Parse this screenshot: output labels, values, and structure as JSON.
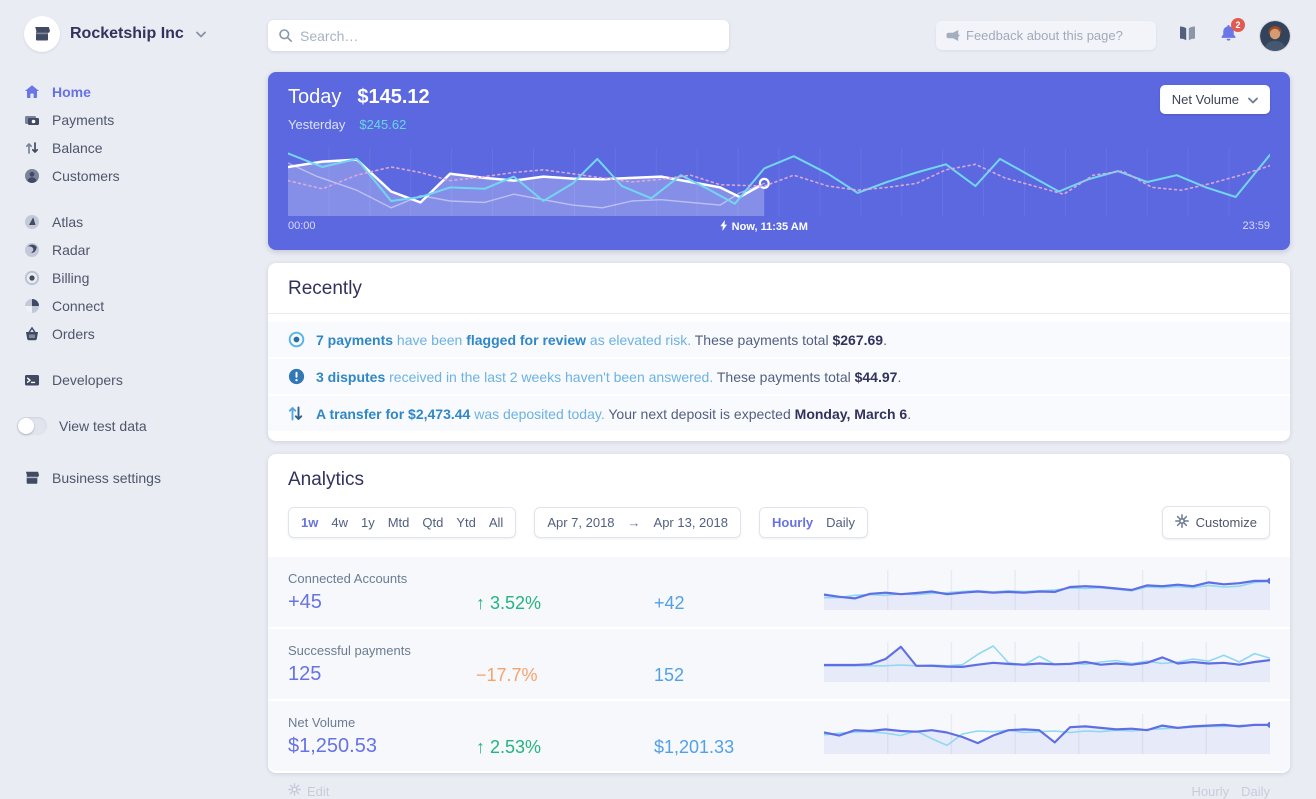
{
  "colors": {
    "accent": "#6772e5",
    "chart_bg": "#5b68e0",
    "green": "#24b47e",
    "orange": "#f5a26b",
    "metric_blue": "#53a0e8",
    "cyan_line": "#73d6f0",
    "pink_line": "#d9a8dc",
    "badge_red": "#e25950",
    "yesterday_teal": "#66d9e2"
  },
  "brand": {
    "name": "Rocketship Inc",
    "icon": "storefront-icon"
  },
  "topbar": {
    "search_placeholder": "Search…",
    "feedback_placeholder": "Feedback about this page?",
    "notification_count": "2"
  },
  "sidebar": {
    "groups": [
      {
        "items": [
          {
            "label": "Home",
            "icon": "home-icon",
            "active": true
          },
          {
            "label": "Payments",
            "icon": "payments-icon"
          },
          {
            "label": "Balance",
            "icon": "balance-icon"
          },
          {
            "label": "Customers",
            "icon": "customers-icon"
          }
        ]
      },
      {
        "items": [
          {
            "label": "Atlas",
            "icon": "atlas-icon"
          },
          {
            "label": "Radar",
            "icon": "radar-icon"
          },
          {
            "label": "Billing",
            "icon": "billing-icon"
          },
          {
            "label": "Connect",
            "icon": "connect-icon"
          },
          {
            "label": "Orders",
            "icon": "orders-icon"
          }
        ]
      },
      {
        "items": [
          {
            "label": "Developers",
            "icon": "developers-icon"
          }
        ]
      }
    ],
    "test_data_label": "View test data",
    "business_label": "Business settings"
  },
  "today_card": {
    "title": "Today",
    "amount": "$145.12",
    "yesterday_label": "Yesterday",
    "yesterday_amount": "$245.62",
    "selector_label": "Net Volume",
    "axis_start": "00:00",
    "axis_now": "Now, 11:35 AM",
    "axis_end": "23:59"
  },
  "recently": {
    "title": "Recently",
    "items": [
      {
        "icon": "review-icon",
        "segments": [
          [
            "7 payments",
            "lb"
          ],
          [
            " have been ",
            "l"
          ],
          [
            "flagged for review",
            "lb"
          ],
          [
            " as elevated risk.",
            "l"
          ],
          [
            " These payments total ",
            "p"
          ],
          [
            "$267.69",
            "b"
          ],
          [
            ".",
            "p"
          ]
        ]
      },
      {
        "icon": "alert-icon",
        "segments": [
          [
            "3 disputes",
            "lb"
          ],
          [
            " received in the last 2 weeks haven't been answered.",
            "l"
          ],
          [
            " These payments total ",
            "p"
          ],
          [
            "$44.97",
            "b"
          ],
          [
            ".",
            "p"
          ]
        ]
      },
      {
        "icon": "transfer-icon",
        "segments": [
          [
            "A transfer for $2,473.44",
            "lb"
          ],
          [
            " was deposited today.",
            "l"
          ],
          [
            " Your next deposit is expected ",
            "p"
          ],
          [
            "Monday, March 6",
            "b"
          ],
          [
            ".",
            "p"
          ]
        ]
      }
    ]
  },
  "analytics": {
    "title": "Analytics",
    "ranges": [
      "1w",
      "4w",
      "1y",
      "Mtd",
      "Qtd",
      "Ytd",
      "All"
    ],
    "active_range": "1w",
    "date_from": "Apr 7, 2018",
    "date_arrow": "→",
    "date_to": "Apr 13, 2018",
    "granularities": [
      "Hourly",
      "Daily"
    ],
    "active_granularity": "Hourly",
    "customize_label": "Customize",
    "rows": [
      {
        "label": "Connected Accounts",
        "value": "+45",
        "change": "↑ 3.52%",
        "direction": "up",
        "previous": "+42"
      },
      {
        "label": "Successful payments",
        "value": "125",
        "change": "−17.7%",
        "direction": "down",
        "previous": "152"
      },
      {
        "label": "Net Volume",
        "value": "$1,250.53",
        "change": "↑ 2.53%",
        "direction": "up",
        "previous": "$1,201.33"
      }
    ]
  },
  "footer": {
    "edit_label": "Edit",
    "granularities": [
      "Hourly",
      "Daily"
    ]
  },
  "chart_data": [
    {
      "type": "line",
      "title": "Net Volume — today vs yesterday vs last week",
      "x_axis": {
        "start": "00:00",
        "now": "Now, 11:35 AM",
        "end": "23:59"
      },
      "today_total": "$145.12",
      "yesterday_total": "$245.62",
      "now_x_percent": 48.5,
      "series": [
        {
          "name": "today",
          "style": "solid-white",
          "area": true,
          "end_marker": true,
          "points": [
            [
              0,
              28
            ],
            [
              3.5,
              20
            ],
            [
              7,
              17
            ],
            [
              10.5,
              64
            ],
            [
              13.5,
              80
            ],
            [
              16.5,
              38
            ],
            [
              20,
              44
            ],
            [
              23,
              48
            ],
            [
              26,
              42
            ],
            [
              29,
              45
            ],
            [
              32,
              46
            ],
            [
              35,
              44
            ],
            [
              38,
              42
            ],
            [
              41,
              50
            ],
            [
              44,
              58
            ],
            [
              46,
              72
            ],
            [
              48.5,
              52
            ]
          ]
        },
        {
          "name": "today-secondary",
          "style": "faint-white",
          "points": [
            [
              0,
              22
            ],
            [
              3,
              42
            ],
            [
              7,
              62
            ],
            [
              10.5,
              88
            ],
            [
              13.5,
              70
            ],
            [
              16.5,
              78
            ],
            [
              20,
              80
            ],
            [
              23,
              68
            ],
            [
              26,
              76
            ],
            [
              29,
              84
            ],
            [
              32,
              88
            ],
            [
              35,
              78
            ],
            [
              38,
              76
            ],
            [
              41,
              80
            ],
            [
              44,
              84
            ],
            [
              46,
              66
            ],
            [
              48.5,
              52
            ]
          ]
        },
        {
          "name": "yesterday",
          "style": "cyan",
          "points": [
            [
              0,
              8
            ],
            [
              3.5,
              28
            ],
            [
              7,
              16
            ],
            [
              10.5,
              78
            ],
            [
              13.5,
              72
            ],
            [
              16.5,
              58
            ],
            [
              20,
              60
            ],
            [
              23,
              42
            ],
            [
              26,
              78
            ],
            [
              29,
              52
            ],
            [
              31.5,
              16
            ],
            [
              34,
              56
            ],
            [
              37,
              74
            ],
            [
              40,
              40
            ],
            [
              43,
              62
            ],
            [
              45.5,
              82
            ],
            [
              48.5,
              30
            ],
            [
              51.5,
              12
            ],
            [
              55,
              38
            ],
            [
              58,
              66
            ],
            [
              61,
              50
            ],
            [
              64,
              36
            ],
            [
              67,
              24
            ],
            [
              70,
              56
            ],
            [
              72.5,
              16
            ],
            [
              75.5,
              40
            ],
            [
              78.5,
              64
            ],
            [
              81.5,
              46
            ],
            [
              84.5,
              34
            ],
            [
              87.5,
              50
            ],
            [
              90.5,
              40
            ],
            [
              93.5,
              58
            ],
            [
              96.5,
              72
            ],
            [
              100,
              10
            ]
          ]
        },
        {
          "name": "last-week",
          "style": "dotted-pink",
          "points": [
            [
              0,
              48
            ],
            [
              3.5,
              60
            ],
            [
              7,
              40
            ],
            [
              10.5,
              28
            ],
            [
              13.5,
              36
            ],
            [
              16.5,
              48
            ],
            [
              20,
              42
            ],
            [
              23,
              36
            ],
            [
              26,
              32
            ],
            [
              29,
              38
            ],
            [
              32,
              44
            ],
            [
              35,
              50
            ],
            [
              38,
              46
            ],
            [
              41,
              40
            ],
            [
              44,
              54
            ],
            [
              48.5,
              56
            ],
            [
              51.5,
              40
            ],
            [
              55,
              56
            ],
            [
              58,
              62
            ],
            [
              61,
              58
            ],
            [
              64,
              52
            ],
            [
              67,
              32
            ],
            [
              70,
              24
            ],
            [
              73,
              44
            ],
            [
              76,
              56
            ],
            [
              79,
              68
            ],
            [
              82,
              40
            ],
            [
              85,
              34
            ],
            [
              88,
              58
            ],
            [
              91,
              62
            ],
            [
              94,
              52
            ],
            [
              97,
              40
            ],
            [
              100,
              26
            ]
          ]
        }
      ]
    },
    {
      "type": "line",
      "metric": "Connected Accounts",
      "end_dot": true,
      "series": [
        {
          "name": "current",
          "y": [
            62,
            68,
            72,
            60,
            57,
            61,
            58,
            54,
            61,
            57,
            54,
            57,
            55,
            57,
            54,
            55,
            42,
            40,
            42,
            46,
            50,
            38,
            40,
            36,
            40,
            30,
            35,
            32,
            26,
            26
          ]
        },
        {
          "name": "previous",
          "y": [
            70,
            70,
            64,
            62,
            64,
            60,
            62,
            59,
            57,
            54,
            52,
            55,
            52,
            54,
            52,
            50,
            45,
            46,
            44,
            48,
            52,
            42,
            44,
            41,
            44,
            38,
            42,
            40,
            30,
            28
          ]
        }
      ]
    },
    {
      "type": "line",
      "metric": "Successful payments",
      "end_dot": false,
      "series": [
        {
          "name": "current",
          "y": [
            58,
            58,
            58,
            56,
            42,
            10,
            60,
            60,
            62,
            63,
            57,
            52,
            55,
            57,
            54,
            56,
            55,
            50,
            57,
            54,
            57,
            52,
            38,
            54,
            50,
            54,
            52,
            57,
            50,
            45
          ]
        },
        {
          "name": "previous",
          "y": [
            60,
            60,
            60,
            60,
            60,
            58,
            60,
            58,
            60,
            57,
            30,
            8,
            52,
            58,
            35,
            56,
            54,
            56,
            50,
            46,
            54,
            48,
            54,
            50,
            42,
            48,
            32,
            50,
            28,
            40
          ]
        }
      ]
    },
    {
      "type": "line",
      "metric": "Net Volume",
      "end_dot": true,
      "series": [
        {
          "name": "current",
          "y": [
            46,
            54,
            40,
            42,
            38,
            42,
            44,
            40,
            46,
            58,
            74,
            54,
            40,
            38,
            40,
            72,
            32,
            30,
            34,
            38,
            36,
            40,
            28,
            34,
            30,
            28,
            26,
            30,
            26,
            26
          ]
        },
        {
          "name": "previous",
          "y": [
            52,
            48,
            45,
            44,
            48,
            54,
            42,
            62,
            80,
            50,
            42,
            44,
            40,
            46,
            44,
            42,
            46,
            42,
            44,
            40,
            42,
            38,
            36,
            34,
            32,
            30,
            30,
            28,
            26,
            26
          ]
        }
      ]
    }
  ]
}
